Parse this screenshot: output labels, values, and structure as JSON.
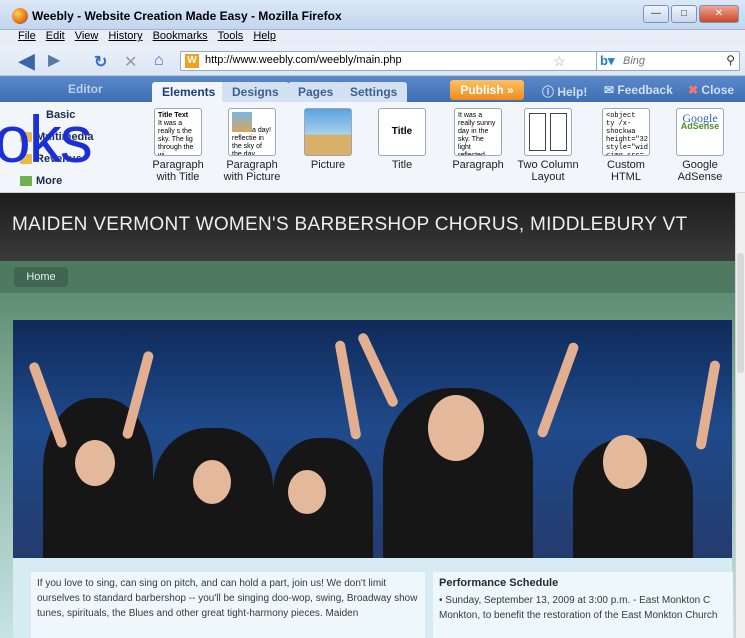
{
  "window": {
    "title": "Weebly - Website Creation Made Easy - Mozilla Firefox"
  },
  "menu": [
    "File",
    "Edit",
    "View",
    "History",
    "Bookmarks",
    "Tools",
    "Help"
  ],
  "nav": {
    "url": "http://www.weebly.com/weebly/main.php",
    "search_placeholder": "Bing"
  },
  "editor": {
    "logo_suffix": "Editor",
    "tabs": [
      "Elements",
      "Designs",
      "Pages",
      "Settings"
    ],
    "publish": "Publish »",
    "links": {
      "help": "Help!",
      "feedback": "Feedback",
      "close": "Close"
    },
    "sidebar": [
      "Basic",
      "Multimedia",
      "Revenue",
      "More"
    ],
    "tools": [
      {
        "label": "Paragraph\nwith Title",
        "thumb_title": "Title Text",
        "thumb_text": "It was a really s the sky. The lig through the wi"
      },
      {
        "label": "Paragraph\nwith Picture",
        "thumb_title": "",
        "thumb_text": "a day! reflectie in the sky of the day through reflected off of the lay-b"
      },
      {
        "label": "Picture",
        "thumb_title": "",
        "thumb_text": ""
      },
      {
        "label": "Title",
        "thumb_title": "Title Text",
        "thumb_text": ""
      },
      {
        "label": "Paragraph",
        "thumb_title": "",
        "thumb_text": "It was a really sunny day in the sky. The light reflected through the window. It was with not a cloud in the sky. reflected off of the lay"
      },
      {
        "label": "Two Column\nLayout",
        "thumb_title": "",
        "thumb_text": ""
      },
      {
        "label": "Custom\nHTML",
        "thumb_title": "",
        "thumb_text": "<object ty /x-shockwa height=\"32 style=\"wid <img src= target=\"_b"
      },
      {
        "label": "Google\nAdSense",
        "thumb_title": "Google",
        "thumb_text": "AdSense"
      }
    ]
  },
  "overlay_text": "oks",
  "site": {
    "title": "MAIDEN VERMONT WOMEN'S BARBERSHOP CHORUS, MIDDLEBURY VT",
    "nav_home": "Home",
    "left_text": "If you love to sing, can sing on pitch, and can hold a part, join us! We don't limit ourselves to standard barbershop -- you'll be singing doo-wop, swing, Broadway show tunes, spirituals, the Blues and other great tight-harmony pieces. Maiden",
    "right_heading": "Performance Schedule",
    "right_text": "•  Sunday, September 13, 2009 at 3:00 p.m. - East Monkton C Monkton, to benefit the restoration of the East Monkton Church"
  }
}
